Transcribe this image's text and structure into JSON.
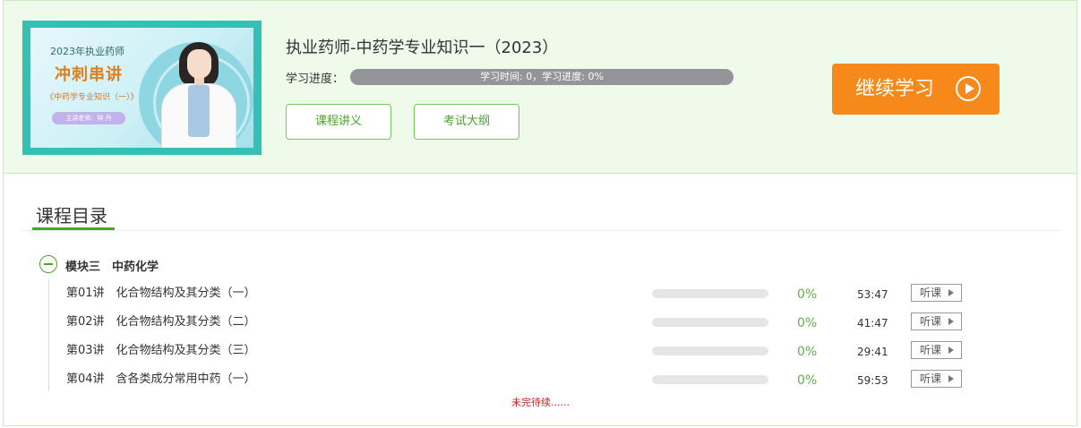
{
  "course": {
    "title": "执业药师-中药学专业知识一（2023）",
    "cover": {
      "year_line": "2023年执业药师",
      "headline": "冲刺串讲",
      "subject": "《中药学专业知识（一）》",
      "teacher": "主讲老师：钟 丹"
    },
    "progress_label": "学习进度：",
    "progress_text": "学习时间: 0，学习进度: 0%",
    "progress_value": 0,
    "buttons": {
      "notes": "课程讲义",
      "syllabus": "考试大纲",
      "continue": "继续学习"
    }
  },
  "catalog": {
    "title": "课程目录",
    "module": "模块三　中药化学",
    "lessons": [
      {
        "name": "第01讲　化合物结构及其分类（一）",
        "progress": 0,
        "percent": "0%",
        "duration": "53:47",
        "action": "听课"
      },
      {
        "name": "第02讲　化合物结构及其分类（二）",
        "progress": 0,
        "percent": "0%",
        "duration": "41:47",
        "action": "听课"
      },
      {
        "name": "第03讲　化合物结构及其分类（三）",
        "progress": 0,
        "percent": "0%",
        "duration": "29:41",
        "action": "听课"
      },
      {
        "name": "第04讲　含各类成分常用中药（一）",
        "progress": 0,
        "percent": "0%",
        "duration": "59:53",
        "action": "听课"
      }
    ],
    "footer_note": "未完待续......"
  },
  "colors": {
    "accent_green": "#46a82a",
    "continue_orange": "#f7881a",
    "header_bg": "#eefaea",
    "progress_track": "#939599",
    "note_red": "#cc1b1b"
  },
  "icons": {
    "continue": "play-circle-icon",
    "listen": "play-triangle-icon",
    "module": "collapse-minus-icon"
  }
}
